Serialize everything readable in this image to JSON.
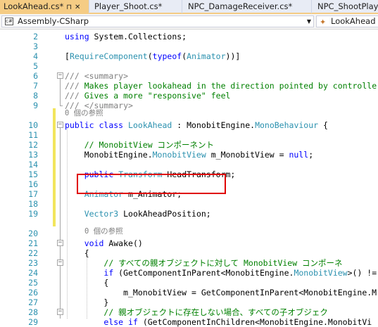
{
  "tabs": [
    {
      "label": "LookAhead.cs*",
      "active": true
    },
    {
      "label": "Player_Shoot.cs*",
      "active": false
    },
    {
      "label": "NPC_DamageReceiver.cs*",
      "active": false
    },
    {
      "label": "NPC_ShootPlaye",
      "active": false
    }
  ],
  "tab_icons": {
    "pin": "⊓",
    "close": "✕"
  },
  "navbar": {
    "project": "Assembly-CSharp",
    "member": "LookAhead",
    "project_icon": "csharp-project-icon",
    "member_icon": "class-icon"
  },
  "colors": {
    "accent": "#f5cc84",
    "keyword": "#0000ff",
    "type": "#2b91af",
    "comment": "#008000",
    "changed_marker": "#f2e55c",
    "highlight_box": "#e00000"
  },
  "lines": [
    {
      "n": "2",
      "tokens": [
        [
          "kw",
          "using"
        ],
        [
          "t",
          " System.Collections;"
        ]
      ]
    },
    {
      "n": "3",
      "tokens": []
    },
    {
      "n": "4",
      "tokens": [
        [
          "t",
          "["
        ],
        [
          "ty",
          "RequireComponent"
        ],
        [
          "t",
          "("
        ],
        [
          "kw",
          "typeof"
        ],
        [
          "t",
          "("
        ],
        [
          "ty",
          "Animator"
        ],
        [
          "t",
          ")"
        ],
        [
          "t",
          ")]"
        ]
      ]
    },
    {
      "n": "5",
      "tokens": []
    },
    {
      "n": "6",
      "tokens": [
        [
          "dc",
          "/// "
        ],
        [
          "dc",
          "<summary>"
        ]
      ]
    },
    {
      "n": "7",
      "tokens": [
        [
          "dc",
          "/// "
        ],
        [
          "cm",
          "Makes player lookahead in the direction pointed by controlle"
        ]
      ]
    },
    {
      "n": "8",
      "tokens": [
        [
          "dc",
          "/// "
        ],
        [
          "cm",
          "Gives a more \"responsive\" feel"
        ]
      ]
    },
    {
      "n": "9",
      "tokens": [
        [
          "dc",
          "/// "
        ],
        [
          "dc",
          "</summary>"
        ]
      ]
    },
    {
      "n": "10",
      "tokens": [
        [
          "kw",
          "public"
        ],
        [
          "t",
          " "
        ],
        [
          "kw",
          "class"
        ],
        [
          "t",
          " "
        ],
        [
          "ty",
          "LookAhead"
        ],
        [
          "t",
          " : MonobitEngine."
        ],
        [
          "ty",
          "MonoBehaviour"
        ],
        [
          "t",
          " {"
        ]
      ]
    },
    {
      "n": "11",
      "tokens": []
    },
    {
      "n": "12",
      "tokens": [
        [
          "t",
          "    "
        ],
        [
          "cm",
          "// MonobitView コンポーネント"
        ]
      ]
    },
    {
      "n": "13",
      "tokens": [
        [
          "t",
          "    MonobitEngine."
        ],
        [
          "ty",
          "MonobitView"
        ],
        [
          "t",
          " m_MonobitView = "
        ],
        [
          "kw",
          "null"
        ],
        [
          "t",
          ";"
        ]
      ]
    },
    {
      "n": "14",
      "tokens": []
    },
    {
      "n": "15",
      "tokens": [
        [
          "t",
          "    "
        ],
        [
          "kw",
          "public"
        ],
        [
          "t",
          " "
        ],
        [
          "ty",
          "Transform"
        ],
        [
          "t",
          " HeadTransform;"
        ]
      ]
    },
    {
      "n": "16",
      "tokens": []
    },
    {
      "n": "17",
      "tokens": [
        [
          "t",
          "    "
        ],
        [
          "ty",
          "Animator"
        ],
        [
          "t",
          " m_Animator;"
        ]
      ]
    },
    {
      "n": "18",
      "tokens": []
    },
    {
      "n": "19",
      "tokens": [
        [
          "t",
          "    "
        ],
        [
          "ty",
          "Vector3"
        ],
        [
          "t",
          " LookAheadPosition;"
        ]
      ]
    },
    {
      "n": "20",
      "tokens": []
    },
    {
      "n": "21",
      "tokens": [
        [
          "t",
          "    "
        ],
        [
          "kw",
          "void"
        ],
        [
          "t",
          " Awake()"
        ]
      ]
    },
    {
      "n": "22",
      "tokens": [
        [
          "t",
          "    {"
        ]
      ]
    },
    {
      "n": "23",
      "tokens": [
        [
          "t",
          "        "
        ],
        [
          "cm",
          "// すべての親オブジェクトに対して MonobitView コンポーネ"
        ]
      ]
    },
    {
      "n": "24",
      "tokens": [
        [
          "t",
          "        "
        ],
        [
          "kw",
          "if"
        ],
        [
          "t",
          " (GetComponentInParent<MonobitEngine."
        ],
        [
          "ty",
          "MonobitView"
        ],
        [
          "t",
          ">() !="
        ]
      ]
    },
    {
      "n": "25",
      "tokens": [
        [
          "t",
          "        {"
        ]
      ]
    },
    {
      "n": "26",
      "tokens": [
        [
          "t",
          "            m_MonobitView = GetComponentInParent<MonobitEngine.M"
        ]
      ]
    },
    {
      "n": "27",
      "tokens": [
        [
          "t",
          "        }"
        ]
      ]
    },
    {
      "n": "28",
      "tokens": [
        [
          "t",
          "        "
        ],
        [
          "cm",
          "// 親オブジェクトに存在しない場合、すべての子オブジェク"
        ]
      ]
    },
    {
      "n": "29",
      "tokens": [
        [
          "t",
          "        "
        ],
        [
          "kw",
          "else"
        ],
        [
          "t",
          " "
        ],
        [
          "kw",
          "if"
        ],
        [
          "t",
          " (GetComponentInChildren<MonobitEngine.MonobitVi"
        ]
      ]
    }
  ],
  "references": [
    {
      "after_line": "9",
      "text": "0 個の参照"
    },
    {
      "after_line": "20",
      "text": "0 個の参照"
    }
  ]
}
